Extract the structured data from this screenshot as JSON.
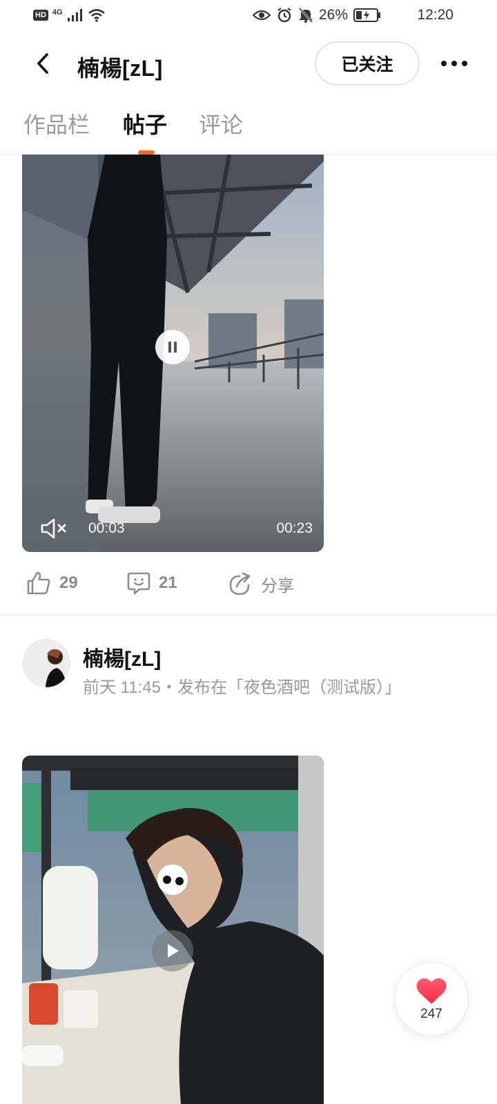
{
  "status_bar": {
    "hd": "HD",
    "network": "4G",
    "battery": "26%",
    "time": "12:20"
  },
  "header": {
    "title": "楠楊[zL]",
    "follow_label": "已关注"
  },
  "tabs": [
    {
      "label": "作品栏",
      "active": false
    },
    {
      "label": "帖子",
      "active": true
    },
    {
      "label": "评论",
      "active": false
    }
  ],
  "accent_color": "#ff6a1f",
  "posts": [
    {
      "video": {
        "current_time": "00:03",
        "total_time": "00:23",
        "state": "playing",
        "muted": true
      },
      "likes": "29",
      "comments": "21",
      "share_label": "分享"
    },
    {
      "author": "楠楊[zL]",
      "meta": "前天 11:45・发布在「夜色酒吧（测试版）」",
      "video": {
        "state": "paused"
      }
    }
  ],
  "floating_like": {
    "count": "247",
    "icon": "heart-icon",
    "color": "#ff3b55"
  }
}
